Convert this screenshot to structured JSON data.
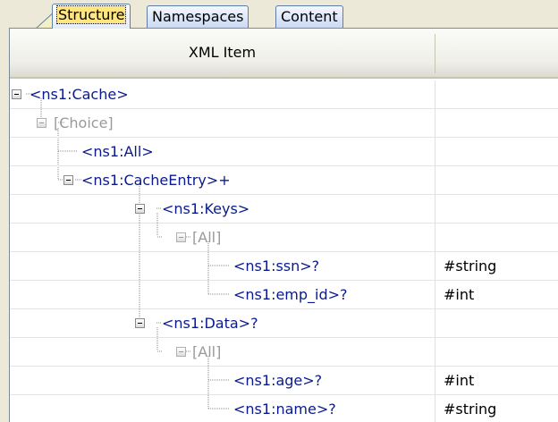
{
  "tabs": [
    {
      "label": "Structure",
      "active": true
    },
    {
      "label": "Namespaces",
      "active": false
    },
    {
      "label": "Content",
      "active": false
    }
  ],
  "columns": {
    "item_header": "XML Item",
    "value_header": ""
  },
  "rows": [
    {
      "label": "<ns1:Cache>",
      "value": "",
      "gray": false
    },
    {
      "label": "[Choice]",
      "value": "",
      "gray": true
    },
    {
      "label": "<ns1:All>",
      "value": "",
      "gray": false
    },
    {
      "label": "<ns1:CacheEntry>+",
      "value": "",
      "gray": false
    },
    {
      "label": "<ns1:Keys>",
      "value": "",
      "gray": false
    },
    {
      "label": "[All]",
      "value": "",
      "gray": true
    },
    {
      "label": "<ns1:ssn>?",
      "value": "#string",
      "gray": false
    },
    {
      "label": "<ns1:emp_id>?",
      "value": "#int",
      "gray": false
    },
    {
      "label": "<ns1:Data>?",
      "value": "",
      "gray": false
    },
    {
      "label": "[All]",
      "value": "",
      "gray": true
    },
    {
      "label": "<ns1:age>?",
      "value": "#int",
      "gray": false
    },
    {
      "label": "<ns1:name>?",
      "value": "#string",
      "gray": false
    }
  ],
  "icons": {
    "expander": "collapse-box-icon",
    "tree_lines": "dotted-connector-lines"
  },
  "colors": {
    "element_text": "#0a1a8c",
    "group_text": "#9a9a9a",
    "tab_border": "#5e7ea8",
    "active_tab_highlight": "#ffe680"
  }
}
